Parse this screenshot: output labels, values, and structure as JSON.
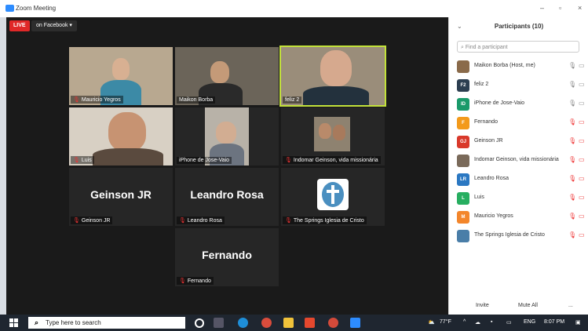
{
  "window": {
    "title": "Zoom Meeting",
    "controls": [
      "–",
      "▫",
      "×"
    ]
  },
  "live": {
    "badge": "LIVE",
    "destination": "on Facebook ▾"
  },
  "tiles": [
    {
      "name": "Mauricio Yegros",
      "muted": true
    },
    {
      "name": "Maikon Borba",
      "muted": false
    },
    {
      "name": "feliz 2",
      "muted": false
    },
    {
      "name": "Luis",
      "muted": true
    },
    {
      "name": "iPhone de Jose-Vaio",
      "muted": false
    },
    {
      "name": "Indomar Geinson, vida missionária",
      "muted": true
    },
    {
      "name": "Geinson JR",
      "display": "Geinson JR",
      "muted": true
    },
    {
      "name": "Leandro Rosa",
      "display": "Leandro Rosa",
      "muted": true
    },
    {
      "name": "The Springs Iglesia de Cristo",
      "muted": true
    },
    {
      "name": "Fernando",
      "display": "Fernando",
      "muted": true
    }
  ],
  "participants": {
    "header": "Participants (10)",
    "search_placeholder": "Find a participant",
    "list": [
      {
        "name": "Maikon Borba (Host, me)",
        "avatar": "",
        "color": "#8a6a4a"
      },
      {
        "name": "feliz 2",
        "avatar": "F2",
        "color": "#2c3e50"
      },
      {
        "name": "iPhone de Jose-Vaio",
        "avatar": "ID",
        "color": "#1a9a6a"
      },
      {
        "name": "Fernando",
        "avatar": "F",
        "color": "#f39a1b"
      },
      {
        "name": "Geinson JR",
        "avatar": "GJ",
        "color": "#d9392b"
      },
      {
        "name": "Indomar Geinson, vida missionária",
        "avatar": "",
        "color": "#7a6a5a"
      },
      {
        "name": "Leandro Rosa",
        "avatar": "LR",
        "color": "#2b78c2"
      },
      {
        "name": "Luis",
        "avatar": "L",
        "color": "#27ae60"
      },
      {
        "name": "Mauricio Yegros",
        "avatar": "M",
        "color": "#f3862b"
      },
      {
        "name": "The Springs Iglesia de Cristo",
        "avatar": "",
        "color": "#4a7ea8"
      }
    ],
    "invite": "Invite",
    "mute_all": "Mute All",
    "more": "..."
  },
  "taskbar": {
    "search_placeholder": "Type here to search",
    "weather": "77°F",
    "lang": "ENG",
    "time": "8:07 PM"
  }
}
